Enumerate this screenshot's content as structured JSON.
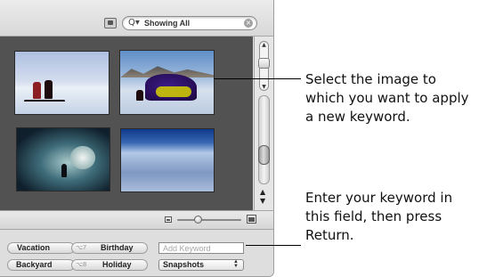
{
  "toolbar": {
    "view_button_icon": "photo-view-icon",
    "search": {
      "icon": "magnifier-dropdown-icon",
      "icon_glyph": "Q▾",
      "value": "Showing All",
      "clear_icon": "clear-search-icon",
      "clear_glyph": "×"
    }
  },
  "browser": {
    "thumbnails": [
      "snowy-expedition-photo",
      "purple-tent-photo",
      "ice-cave-photo",
      "snowfield-photo"
    ]
  },
  "scrollbar": {
    "zoom_icon": "zoom-control-icon",
    "arrow_up": "▲",
    "arrow_down": "▼"
  },
  "thumbnail_size": {
    "min_icon": "small-photo-icon",
    "max_icon": "large-photo-icon",
    "level": 0.3
  },
  "keywords_panel": {
    "buttons": [
      {
        "label": "Vacation",
        "shortcut": ""
      },
      {
        "label": "Birthday",
        "shortcut": "⌥7"
      },
      {
        "label": "Backyard",
        "shortcut": ""
      },
      {
        "label": "Holiday",
        "shortcut": "⌥8"
      }
    ],
    "keyword_input_placeholder": "Add Keyword",
    "set_select_value": "Snapshots",
    "set_select_arrows": "▲▼"
  },
  "callouts": [
    {
      "text": "Select the image to which you want to apply a new keyword.",
      "lines": [
        "Select the image to",
        "which you want to apply",
        "a new keyword."
      ]
    },
    {
      "text": "Enter your keyword in this field, then press Return.",
      "lines": [
        "Enter your keyword in",
        "this field, then press",
        "Return."
      ]
    }
  ]
}
